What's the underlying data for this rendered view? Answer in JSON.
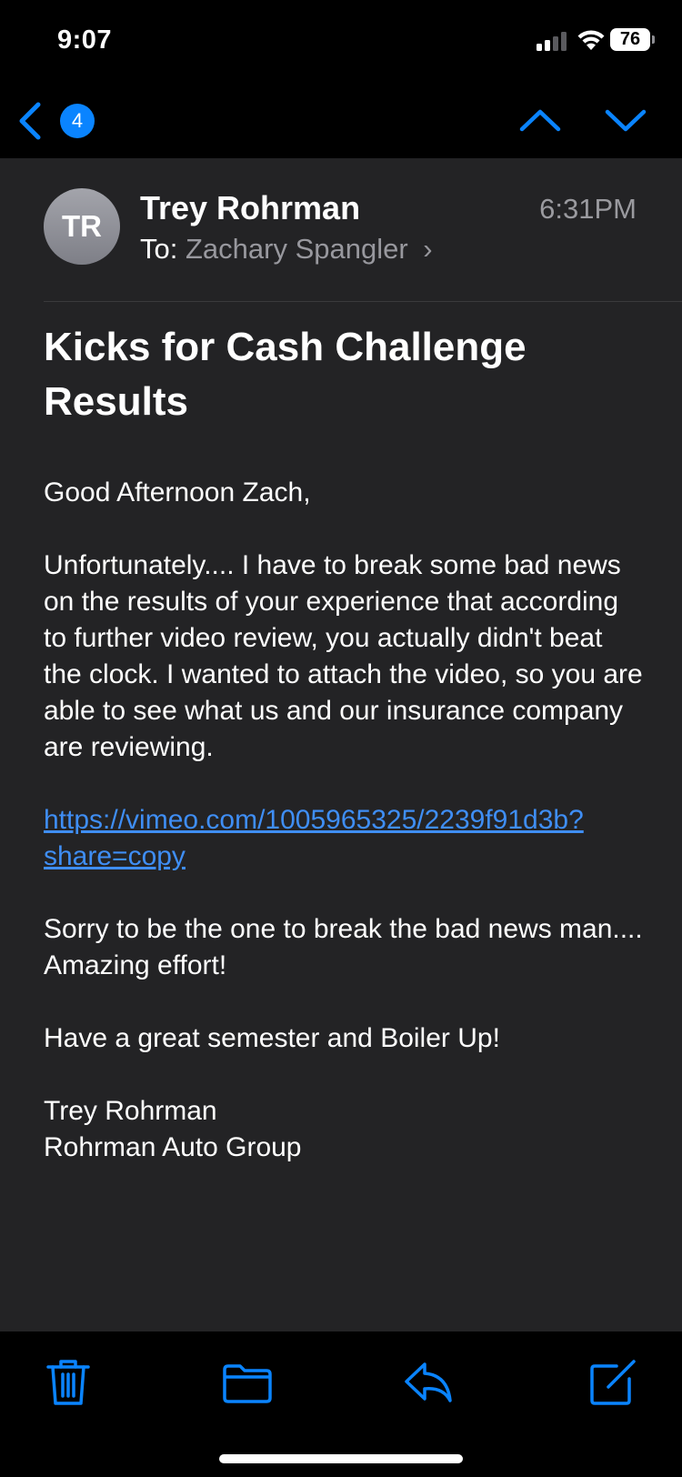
{
  "status_bar": {
    "time": "9:07",
    "battery": "76"
  },
  "nav": {
    "unread_count": "4",
    "icons": [
      "back-chevron-icon",
      "chevron-up-icon",
      "chevron-down-icon"
    ]
  },
  "message": {
    "sender_initials": "TR",
    "sender_name": "Trey Rohrman",
    "time": "6:31PM",
    "to_label": "To:",
    "recipient": "Zachary Spangler",
    "subject": "Kicks for Cash Challenge Results",
    "greeting": "Good Afternoon Zach,",
    "paragraph_1": "Unfortunately.... I have to break some bad news on the results of your experience that according to further video review, you actually didn't beat the clock. I wanted to attach the video, so you are able to see what us and our insurance company are reviewing.",
    "link": "https://vimeo.com/1005965325/2239f91d3b?share=copy",
    "paragraph_2": "Sorry to be the one to break the bad news man.... Amazing effort!",
    "paragraph_3": "Have a great semester and Boiler Up!",
    "signature_name": "Trey Rohrman",
    "signature_company": "Rohrman Auto Group"
  },
  "toolbar": {
    "icons": [
      "trash-icon",
      "folder-icon",
      "reply-icon",
      "compose-icon"
    ]
  },
  "colors": {
    "accent": "#0a84ff",
    "link": "#3f8ef5",
    "background": "#232325",
    "secondary_text": "#98989e"
  }
}
